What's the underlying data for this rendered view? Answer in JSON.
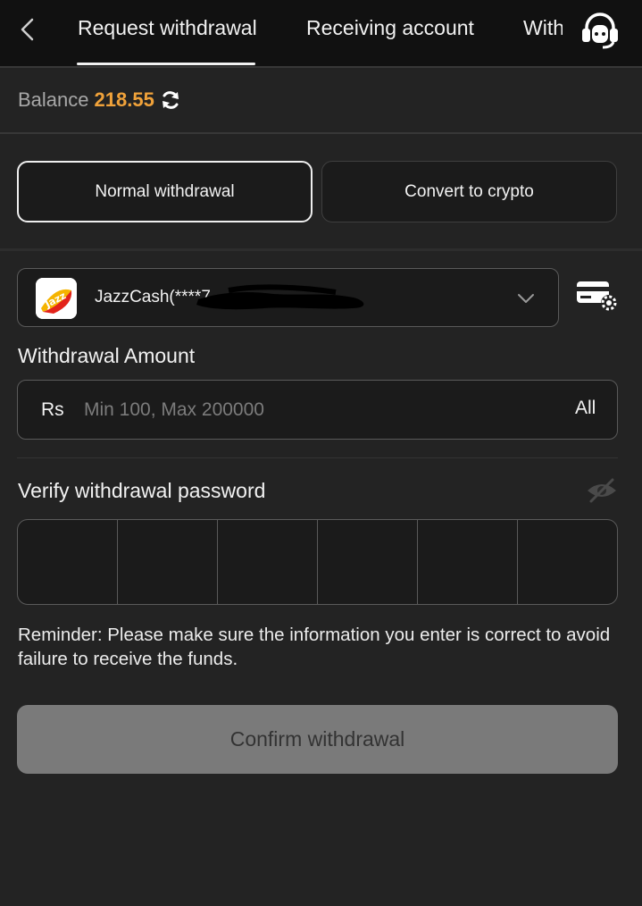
{
  "header": {
    "tabs": [
      {
        "label": "Request withdrawal",
        "active": true
      },
      {
        "label": "Receiving account",
        "active": false
      },
      {
        "label": "With",
        "active": false
      }
    ],
    "back_icon": "chevron-left-icon",
    "support_icon": "headset-icon"
  },
  "balance": {
    "label": "Balance",
    "value": "218.55",
    "refresh_icon": "refresh-icon",
    "value_color": "#f0a23a"
  },
  "modes": {
    "normal_label": "Normal withdrawal",
    "crypto_label": "Convert to crypto",
    "selected": "Normal withdrawal"
  },
  "account": {
    "name": "JazzCash(****7",
    "logo_icon": "jazzcash-logo-icon",
    "logo_text": "Jazz",
    "dropdown_icon": "chevron-down-icon",
    "manage_icon": "card-settings-icon"
  },
  "amount": {
    "label": "Withdrawal Amount",
    "currency": "Rs",
    "placeholder": "Min 100, Max 200000",
    "all_label": "All"
  },
  "password": {
    "label": "Verify withdrawal password",
    "visibility_icon": "eye-off-icon",
    "digits": 6
  },
  "reminder": "Reminder: Please make sure the information you enter is correct to avoid failure to receive the funds.",
  "confirm_label": "Confirm withdrawal"
}
